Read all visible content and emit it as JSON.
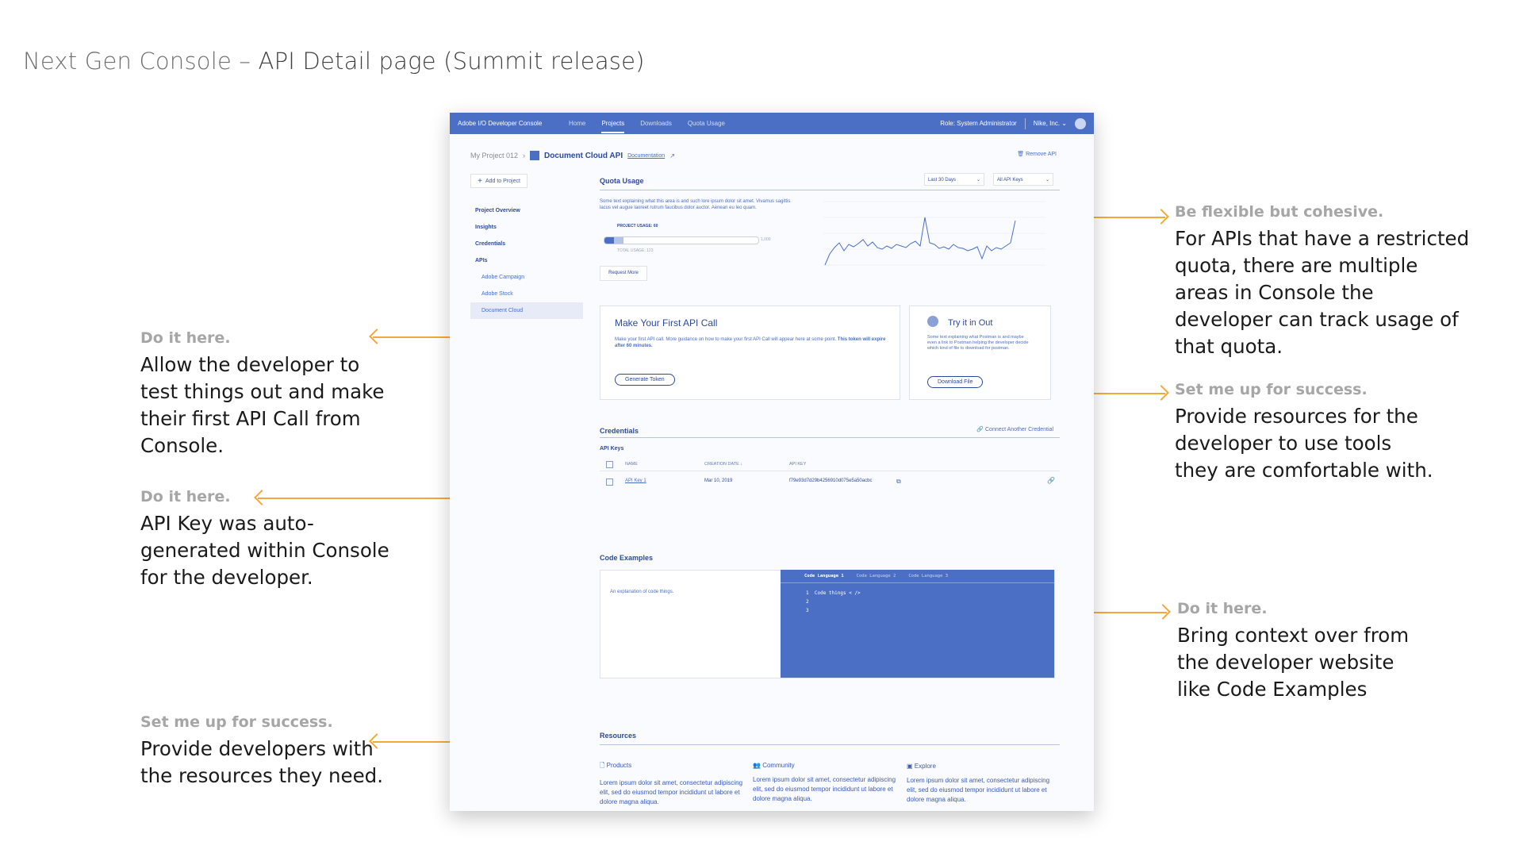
{
  "slide": {
    "title_light": "Next Gen Console – ",
    "title_dark": "API Detail page (Summit release)"
  },
  "annotations": {
    "flexible": {
      "lead": "Be flexible but cohesive.",
      "body": "For APIs that have a restricted quota, there are multiple areas in Console the developer can track usage of that quota."
    },
    "setup_tools": {
      "lead": "Set me up for success.",
      "body": "Provide resources for the developer to use tools they are comfortable with."
    },
    "do_it_call": {
      "lead": "Do it here.",
      "body": "Allow the developer to test things out and make their first API Call from Console."
    },
    "do_it_key": {
      "lead": "Do it here.",
      "body": "API Key was auto-generated within Console for the developer."
    },
    "do_it_code": {
      "lead": "Do it here.",
      "body": "Bring context over from the developer website like Code Examples"
    },
    "setup_resources": {
      "lead": "Set me up for success.",
      "body": "Provide developers with the resources they need."
    }
  },
  "app": {
    "brand": "Adobe I/O Developer Console",
    "nav": [
      "Home",
      "Projects",
      "Downloads",
      "Quota Usage"
    ],
    "role": "Role: System Administrator",
    "org": "Nike, Inc.",
    "breadcrumb_project": "My Project 012",
    "api_name": "Document Cloud API",
    "documentation": "Documentation",
    "remove_api": "Remove API",
    "add_to_project": "Add to Project",
    "sidenav": {
      "overview": "Project Overview",
      "insights": "Insights",
      "credentials": "Credentials",
      "apis": "APIs",
      "campaign": "Adobe Campaign",
      "stock": "Adobe Stock",
      "doccloud": "Document Cloud"
    }
  },
  "quota": {
    "title": "Quota Usage",
    "range_select": "Last 30 Days",
    "keys_select": "All API Keys",
    "description": "Some text explaining what this area is and such lore ipsum dolor sit amet. Vivamus sagittis lacus vel augue laoreet rutrum faucibus dolor auctor. Aenean eu leo quam.",
    "project_usage": "PROJECT USAGE: 60",
    "limit": "1,000",
    "total_usage": "TOTAL USAGE: 123",
    "progress_project": 0.06,
    "progress_total": 0.123,
    "request_more": "Request More"
  },
  "first_call": {
    "title": "Make Your First API Call",
    "text_a": "Make your first API call. More guidance on how to make your first API Call will appear here at some point. ",
    "text_b": "This token will expire after 60 minutes.",
    "button": "Generate Token"
  },
  "try_it": {
    "title": "Try it in Out",
    "text": "Some text explaining what Postman is and maybe even a link to Postman helping the developer decide which kind of file to download for postman.",
    "button": "Download File"
  },
  "credentials": {
    "title": "Credentials",
    "connect": "Connect Another Credential",
    "subtitle": "API Keys",
    "col_name": "NAME",
    "col_date": "CREATION DATE",
    "col_key": "API KEY",
    "row_name": "API Key 1",
    "row_date": "Mar 10, 2019",
    "row_key": "f79e93d7d29b4256910d075e5a50acbc"
  },
  "code": {
    "title": "Code Examples",
    "explanation": "An explanation of code things.",
    "tabs": [
      "Code Language 1",
      "Code Language 2",
      "Code Language 3"
    ],
    "line1": "Code things < />",
    "ln1": "1",
    "ln2": "2",
    "ln3": "3"
  },
  "resources": {
    "title": "Resources",
    "products": "Products",
    "community": "Community",
    "explore": "Explore",
    "lorem": "Lorem ipsum dolor sit amet, consectetur adipiscing elit, sed do eiusmod tempor incididunt ut labore et dolore magna aliqua."
  },
  "colors": {
    "accent": "#4a6fc4",
    "arrow": "#f2a93b"
  }
}
